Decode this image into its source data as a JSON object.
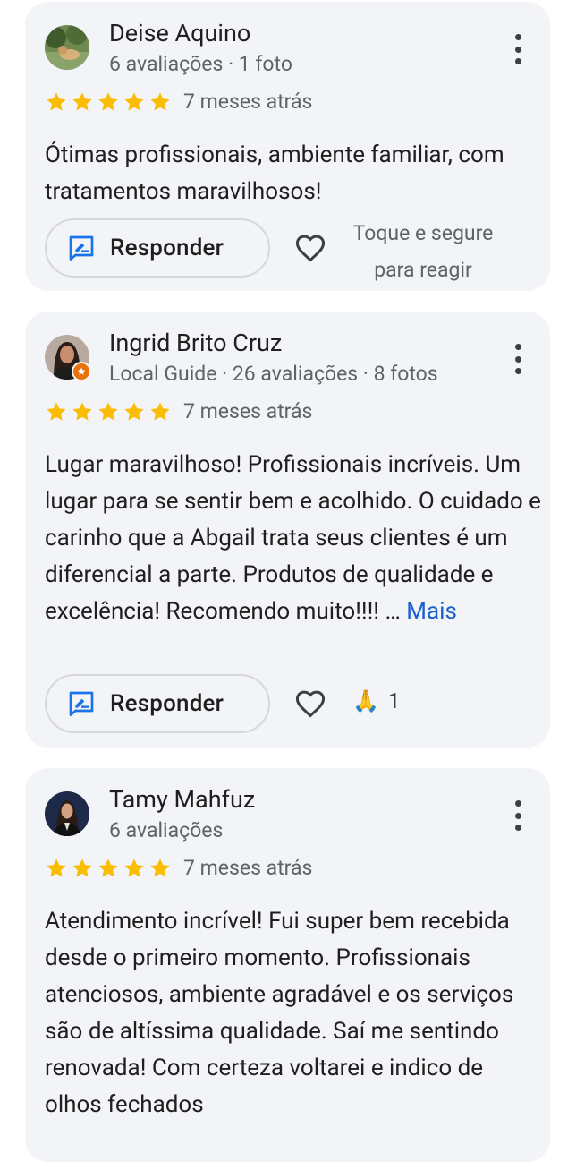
{
  "reviews": [
    {
      "name": "Deise Aquino",
      "meta": "6 avaliações · 1 foto",
      "rating": 5,
      "time": "7 meses atrás",
      "text": "Ótimas profissionais, ambiente familiar, com tratamentos maravilhosos!",
      "reply_label": "Responder",
      "hint_line1": "Toque e segure",
      "hint_line2": "para reagir"
    },
    {
      "name": "Ingrid Brito Cruz",
      "meta": "Local Guide · 26 avaliações · 8 fotos",
      "rating": 5,
      "time": "7 meses atrás",
      "text": "Lugar maravilhoso! Profissionais incríveis. Um lugar para se sentir bem e acolhido. O cuidado e carinho que a Abgail trata seus clientes é um diferencial a parte. Produtos de qualidade e excelência! Recomendo muito!!!! … ",
      "more_label": "Mais",
      "reply_label": "Responder",
      "reaction_emoji": "🙏",
      "reaction_count": "1"
    },
    {
      "name": "Tamy Mahfuz",
      "meta": "6 avaliações",
      "rating": 5,
      "time": "7 meses atrás",
      "text": "Atendimento incrível! Fui super bem recebida desde o primeiro momento. Profissionais atenciosos, ambiente agradável e os serviços são de altíssima qualidade. Saí me sentindo renovada! Com certeza voltarei e indico de olhos fechados"
    }
  ],
  "colors": {
    "card_bg": "#f3f4f7",
    "star": "#fbbc04",
    "link": "#1a5fd0",
    "reply_icon": "#1a73e8",
    "local_guide_badge": "#e8710a"
  }
}
